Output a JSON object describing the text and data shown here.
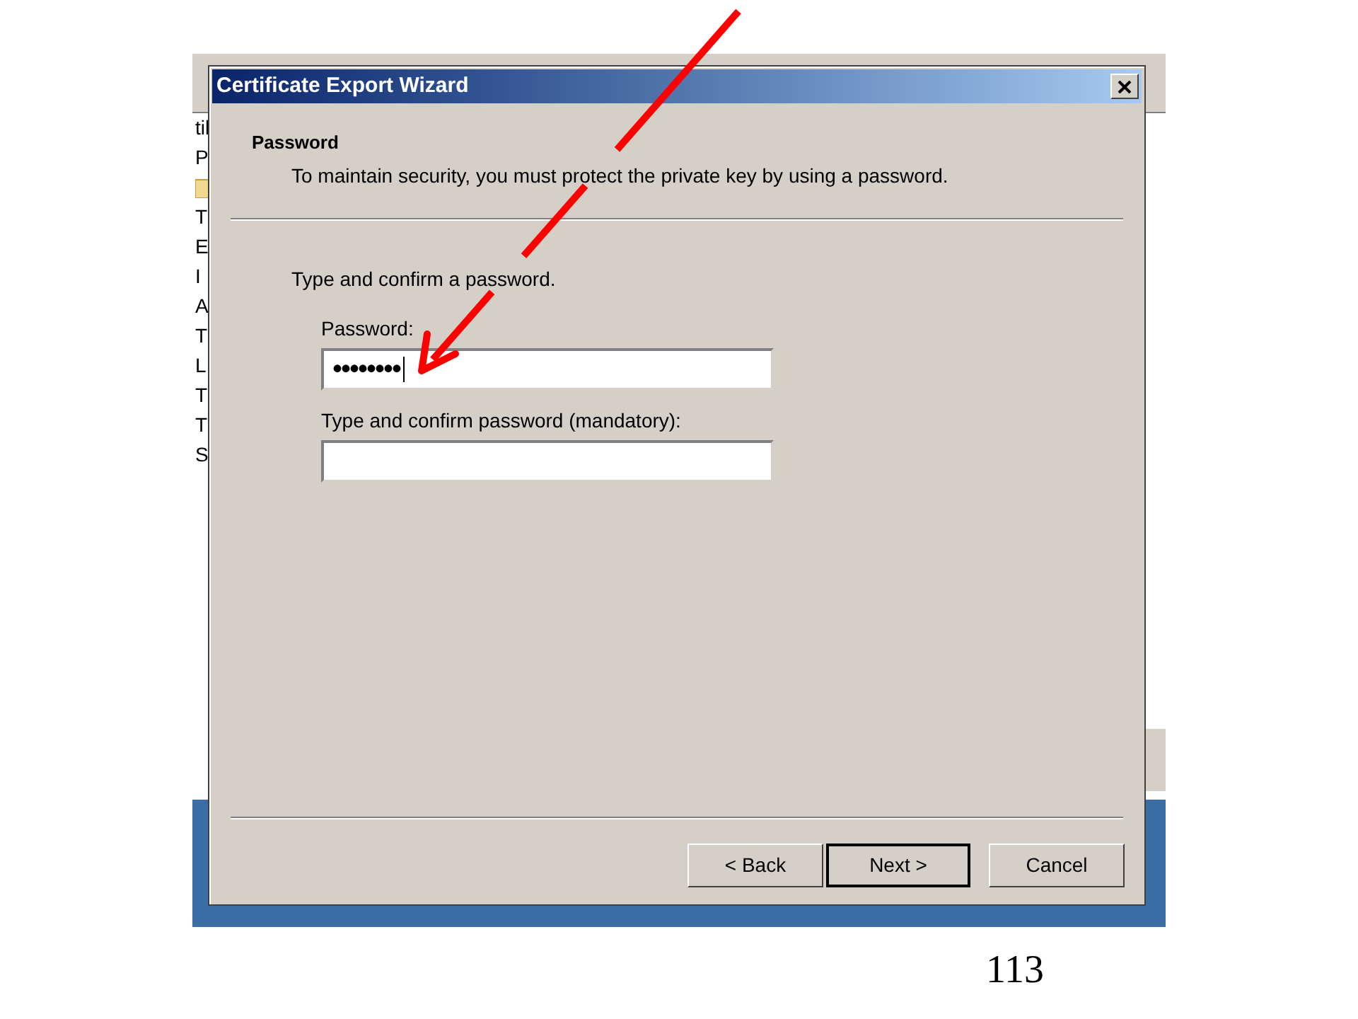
{
  "background_window": {
    "letters": [
      "til",
      "P",
      "T",
      "E",
      "I",
      "A",
      "T",
      "L",
      "T",
      "T",
      "S"
    ]
  },
  "dialog": {
    "title": "Certificate Export Wizard",
    "header": {
      "title": "Password",
      "description": "To maintain security, you must protect the private key by using a password."
    },
    "prompt": "Type and confirm a password.",
    "fields": [
      {
        "label": "Password:",
        "value": "••••••••",
        "focused": true
      },
      {
        "label": "Type and confirm password (mandatory):",
        "focused": false
      }
    ],
    "buttons": [
      {
        "label": "< Back",
        "default": false
      },
      {
        "label": "Next >",
        "default": true
      },
      {
        "label": "Cancel",
        "default": false
      }
    ]
  },
  "slide_number": "113"
}
